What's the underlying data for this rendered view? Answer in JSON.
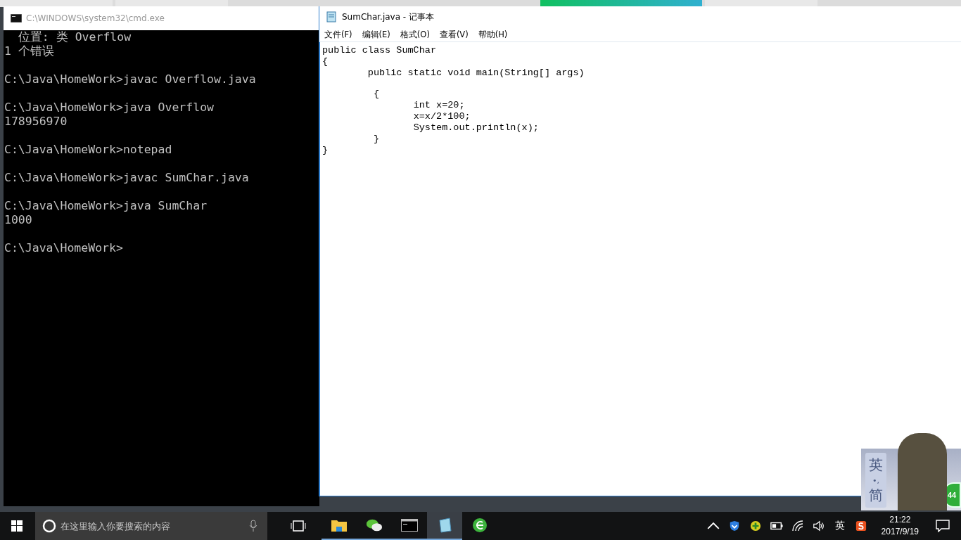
{
  "console_window": {
    "title": "C:\\WINDOWS\\system32\\cmd.exe",
    "blocks": [
      [
        "  位置: 类 Overflow",
        "1 个错误"
      ],
      [
        "C:\\Java\\HomeWork>javac Overflow.java"
      ],
      [
        "C:\\Java\\HomeWork>java Overflow",
        "178956970"
      ],
      [
        "C:\\Java\\HomeWork>notepad"
      ],
      [
        "C:\\Java\\HomeWork>javac SumChar.java"
      ],
      [
        "C:\\Java\\HomeWork>java SumChar",
        "1000"
      ],
      [
        "C:\\Java\\HomeWork>"
      ]
    ]
  },
  "notepad_window": {
    "title": "SumChar.java - 记事本",
    "menu": [
      "文件(F)",
      "编辑(E)",
      "格式(O)",
      "查看(V)",
      "帮助(H)"
    ],
    "blocks": [
      [
        "public class SumChar",
        "{",
        "\tpublic static void main(String[] args)"
      ],
      [
        "\t {",
        "\t\tint x=20;",
        "\t\tx=x/2*100;",
        "\t\tSystem.out.println(x);",
        "\t }",
        "}"
      ]
    ]
  },
  "ime_panel": {
    "top": "英",
    "middle": "•,",
    "bottom": "简",
    "badge": "44"
  },
  "taskbar": {
    "search": {
      "placeholder": "在这里输入你要搜索的内容"
    },
    "apps": [
      {
        "kind": "folder",
        "running": true,
        "selected": false
      },
      {
        "kind": "chat",
        "running": true,
        "selected": false
      },
      {
        "kind": "console",
        "running": true,
        "selected": false
      },
      {
        "kind": "notepad",
        "running": true,
        "selected": true
      },
      {
        "kind": "browser",
        "running": false,
        "selected": false
      }
    ],
    "language": "英",
    "time": "21:22",
    "date": "2017/9/19"
  }
}
